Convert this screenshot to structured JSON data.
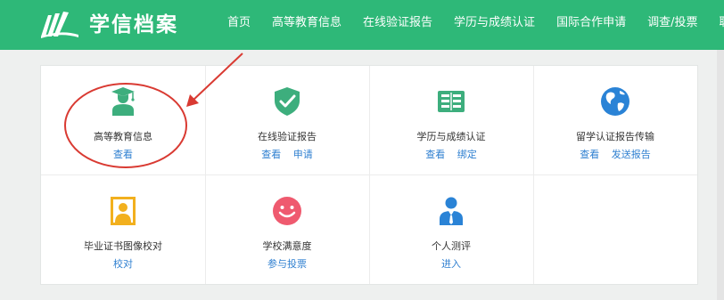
{
  "header": {
    "brand": "学信档案",
    "nav": [
      "首页",
      "高等教育信息",
      "在线验证报告",
      "学历与成绩认证",
      "国际合作申请",
      "调查/投票",
      "联"
    ]
  },
  "cards": [
    {
      "title": "高等教育信息",
      "links": [
        "查看"
      ],
      "icon": "graduate-icon"
    },
    {
      "title": "在线验证报告",
      "links": [
        "查看",
        "申请"
      ],
      "icon": "shield-check-icon"
    },
    {
      "title": "学历与成绩认证",
      "links": [
        "查看",
        "绑定"
      ],
      "icon": "book-icon"
    },
    {
      "title": "留学认证报告传输",
      "links": [
        "查看",
        "发送报告"
      ],
      "icon": "globe-icon"
    },
    {
      "title": "毕业证书图像校对",
      "links": [
        "校对"
      ],
      "icon": "portrait-icon"
    },
    {
      "title": "学校满意度",
      "links": [
        "参与投票"
      ],
      "icon": "smiley-icon"
    },
    {
      "title": "个人测评",
      "links": [
        "进入"
      ],
      "icon": "person-tie-icon"
    }
  ],
  "colors": {
    "brand_green": "#2eb878",
    "icon_green": "#3dae7d",
    "icon_blue": "#2a83d6",
    "icon_yellow": "#f2b01e",
    "icon_red": "#ef5a6f",
    "link_blue": "#2e7fd0",
    "annotation_red": "#d93a32"
  }
}
